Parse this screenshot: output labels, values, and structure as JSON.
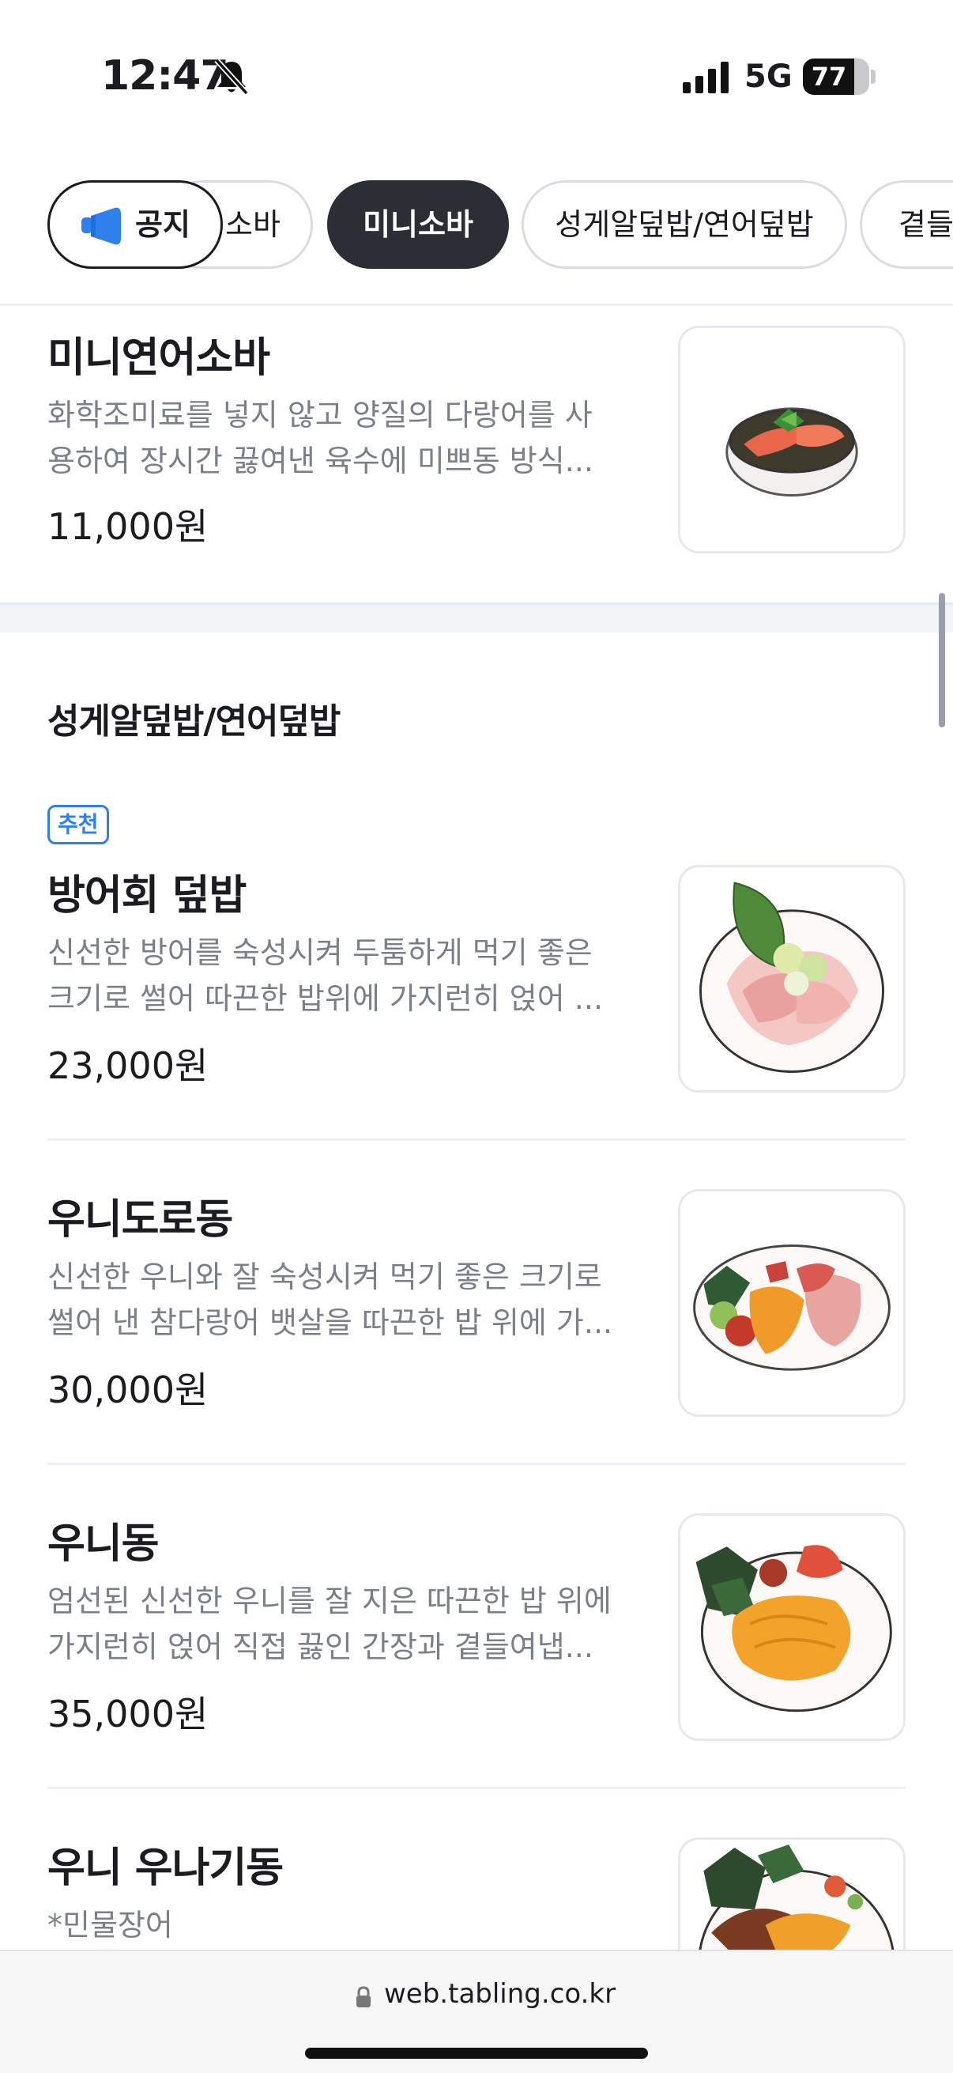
{
  "status_bar": {
    "time": "12:47",
    "network": "5G",
    "battery_level": "77",
    "battery_fraction": 0.77
  },
  "tabs": {
    "notice": "공지",
    "items": [
      "소바",
      "미니소바",
      "성게알덮밥/연어덮밥",
      "곁들"
    ],
    "active": "미니소바"
  },
  "menu": {
    "top_item": {
      "title": "미니연어소바",
      "desc_lines": [
        "화학조미료를 넣지 않고 양질의 다랑어를 사",
        "용하여 장시간 끓여낸 육수에 미쁘동 방식..."
      ],
      "price": "11,000원"
    },
    "section": {
      "title": "성게알덮밥/연어덮밥",
      "badge": "추천",
      "items": [
        {
          "title": "방어회 덮밥",
          "desc_lines": [
            "신선한 방어를 숙성시켜 두툼하게 먹기 좋은",
            "크기로 썰어 따끈한 밥위에 가지런히 얹어 ..."
          ],
          "price": "23,000원"
        },
        {
          "title": "우니도로동",
          "desc_lines": [
            "신선한 우니와 잘 숙성시켜 먹기 좋은 크기로",
            "썰어 낸 참다랑어 뱃살을 따끈한 밥 위에 가..."
          ],
          "price": "30,000원"
        },
        {
          "title": "우니동",
          "desc_lines": [
            "엄선된 신선한 우니를 잘 지은 따끈한 밥 위에",
            "가지런히 얹어 직접 끓인 간장과 곁들여냅..."
          ],
          "price": "35,000원"
        },
        {
          "title": "우니 우나기동",
          "desc_lines": [
            "*민물장어"
          ],
          "price": ""
        }
      ]
    }
  },
  "url_bar": {
    "url": "web.tabling.co.kr"
  },
  "colors": {
    "accent_blue": "#2f80ed",
    "active_tab_bg": "#2b2e35",
    "desc_gray": "#7a7f88"
  },
  "icons": [
    "bell-slash-icon",
    "signal-icon",
    "battery-icon",
    "megaphone-icon",
    "lock-icon"
  ]
}
